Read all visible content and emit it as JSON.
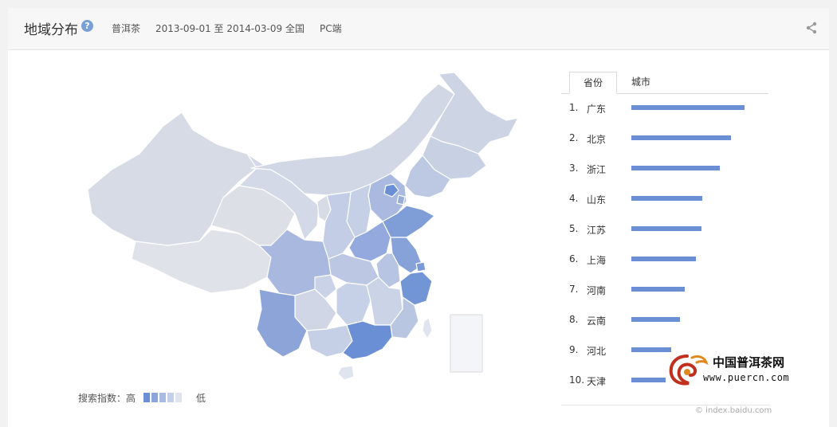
{
  "header": {
    "title": "地域分布",
    "help": "?",
    "keyword": "普洱茶",
    "date_range": "2013-09-01 至 2014-03-09",
    "region": "全国",
    "platform": "PC端",
    "share_icon": "share-icon"
  },
  "legend": {
    "label": "搜索指数：高",
    "low": "低",
    "colors": [
      "#6a8fd4",
      "#8aa6dd",
      "#a7bbe3",
      "#c4d0ea",
      "#dfe4ef"
    ]
  },
  "tabs": [
    {
      "label": "省份",
      "active": true
    },
    {
      "label": "城市",
      "active": false
    }
  ],
  "ranking": [
    {
      "rank": "1.",
      "name": "广东",
      "value": 1.0
    },
    {
      "rank": "2.",
      "name": "北京",
      "value": 0.88
    },
    {
      "rank": "3.",
      "name": "浙江",
      "value": 0.78
    },
    {
      "rank": "4.",
      "name": "山东",
      "value": 0.63
    },
    {
      "rank": "5.",
      "name": "江苏",
      "value": 0.62
    },
    {
      "rank": "6.",
      "name": "上海",
      "value": 0.57
    },
    {
      "rank": "7.",
      "name": "河南",
      "value": 0.47
    },
    {
      "rank": "8.",
      "name": "云南",
      "value": 0.43
    },
    {
      "rank": "9.",
      "name": "河北",
      "value": 0.35
    },
    {
      "rank": "10.",
      "name": "天津",
      "value": 0.3
    }
  ],
  "source": "© index.baidu.com",
  "watermark": {
    "name": "中国普洱茶网",
    "url": "www.puercn.com"
  }
}
